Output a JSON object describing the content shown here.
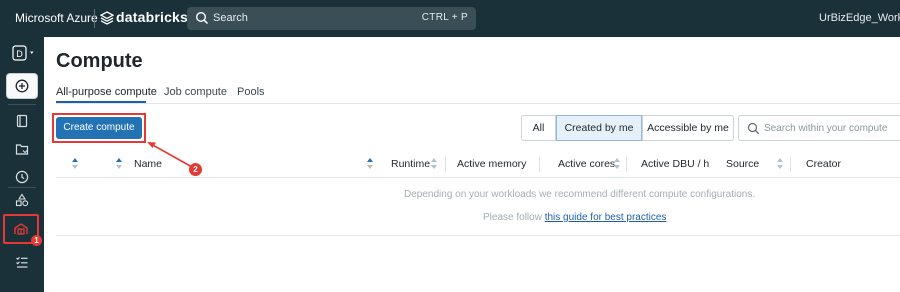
{
  "topbar": {
    "brand": "Microsoft Azure",
    "product": "databricks",
    "search_label": "Search",
    "search_shortcut": "CTRL + P",
    "workspace": "UrBizEdge_Workspace_"
  },
  "sidebar": {
    "workspace_letter": "D",
    "items": [
      {
        "icon": "plus-circle-icon"
      },
      {
        "icon": "notebook-icon"
      },
      {
        "icon": "folder-icon"
      },
      {
        "icon": "clock-icon"
      },
      {
        "icon": "shapes-icon"
      },
      {
        "icon": "compute-icon"
      },
      {
        "icon": "workflows-icon"
      }
    ]
  },
  "page": {
    "title": "Compute",
    "tabs": [
      {
        "label": "All-purpose compute",
        "active": true
      },
      {
        "label": "Job compute",
        "active": false
      },
      {
        "label": "Pools",
        "active": false
      }
    ],
    "create_button": "Create compute",
    "filter_segments": [
      {
        "label": "All",
        "active": false
      },
      {
        "label": "Created by me",
        "active": true
      },
      {
        "label": "Accessible by me",
        "active": false
      }
    ],
    "search_placeholder": "Search within your compute"
  },
  "table": {
    "columns": [
      "Name",
      "Runtime",
      "Active memory",
      "Active cores",
      "Active DBU / h",
      "Source",
      "Creator"
    ],
    "empty_message": "Depending on your workloads we recommend different compute configurations.",
    "empty_prefix": "Please follow ",
    "empty_link": "this guide for best practices"
  },
  "annotations": {
    "badge_1": "1",
    "badge_2": "2"
  },
  "colors": {
    "topbar_bg": "#1b3139",
    "primary_button": "#2272b4",
    "annotation_red": "#e53935",
    "link_blue": "#1f5fa8"
  }
}
